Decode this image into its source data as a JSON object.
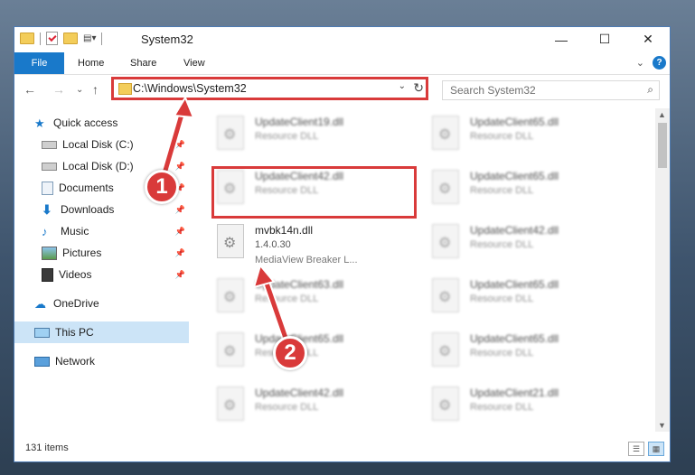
{
  "window": {
    "title": "System32",
    "controls": {
      "minimize": "—",
      "maximize": "☐",
      "close": "✕"
    }
  },
  "ribbon": {
    "file": "File",
    "tabs": [
      "Home",
      "Share",
      "View"
    ],
    "expand": "⌄",
    "help": "?"
  },
  "navigation": {
    "back": "←",
    "forward": "→",
    "recent": "⌄",
    "up": "↑",
    "address": "C:\\Windows\\System32",
    "address_dropdown": "⌄",
    "refresh": "↻",
    "search_placeholder": "Search System32",
    "search_icon": "⌕"
  },
  "sidebar": {
    "items": [
      {
        "label": "Quick access",
        "icon": "star-icon",
        "pinned": false
      },
      {
        "label": "Local Disk (C:)",
        "icon": "drive-icon",
        "pinned": true
      },
      {
        "label": "Local Disk (D:)",
        "icon": "drive-icon",
        "pinned": true
      },
      {
        "label": "Documents",
        "icon": "documents-icon",
        "pinned": true
      },
      {
        "label": "Downloads",
        "icon": "download-icon",
        "pinned": true
      },
      {
        "label": "Music",
        "icon": "music-icon",
        "pinned": true
      },
      {
        "label": "Pictures",
        "icon": "pictures-icon",
        "pinned": true
      },
      {
        "label": "Videos",
        "icon": "videos-icon",
        "pinned": true
      },
      {
        "label": "OneDrive",
        "icon": "cloud-icon",
        "pinned": false
      },
      {
        "label": "This PC",
        "icon": "computer-icon",
        "pinned": false,
        "selected": true
      },
      {
        "label": "Network",
        "icon": "network-icon",
        "pinned": false
      }
    ]
  },
  "files": {
    "highlighted": {
      "name": "mvbk14n.dll",
      "version": "1.4.0.30",
      "description": "MediaView Breaker L..."
    },
    "left_column": [
      {
        "name": "UpdateClient19.dll",
        "description": "Resource DLL"
      },
      {
        "name": "UpdateClient42.dll",
        "description": "Resource DLL"
      },
      {
        "name": "UpdateClient63.dll",
        "description": "Resource DLL"
      },
      {
        "name": "UpdateClient65.dll",
        "description": "Resource DLL"
      },
      {
        "name": "UpdateClient42.dll",
        "description": "Resource DLL"
      }
    ],
    "right_column": [
      {
        "name": "UpdateClient65.dll",
        "description": "Resource DLL"
      },
      {
        "name": "UpdateClient65.dll",
        "description": "Resource DLL"
      },
      {
        "name": "UpdateClient42.dll",
        "description": "Resource DLL"
      },
      {
        "name": "UpdateClient65.dll",
        "description": "Resource DLL"
      },
      {
        "name": "UpdateClient65.dll",
        "description": "Resource DLL"
      },
      {
        "name": "UpdateClient21.dll",
        "description": "Resource DLL"
      }
    ]
  },
  "statusbar": {
    "count": "131 items"
  },
  "callouts": [
    "1",
    "2"
  ],
  "colors": {
    "accent": "#1979ca",
    "highlight": "#d93a3a",
    "selected": "#cce4f7"
  }
}
